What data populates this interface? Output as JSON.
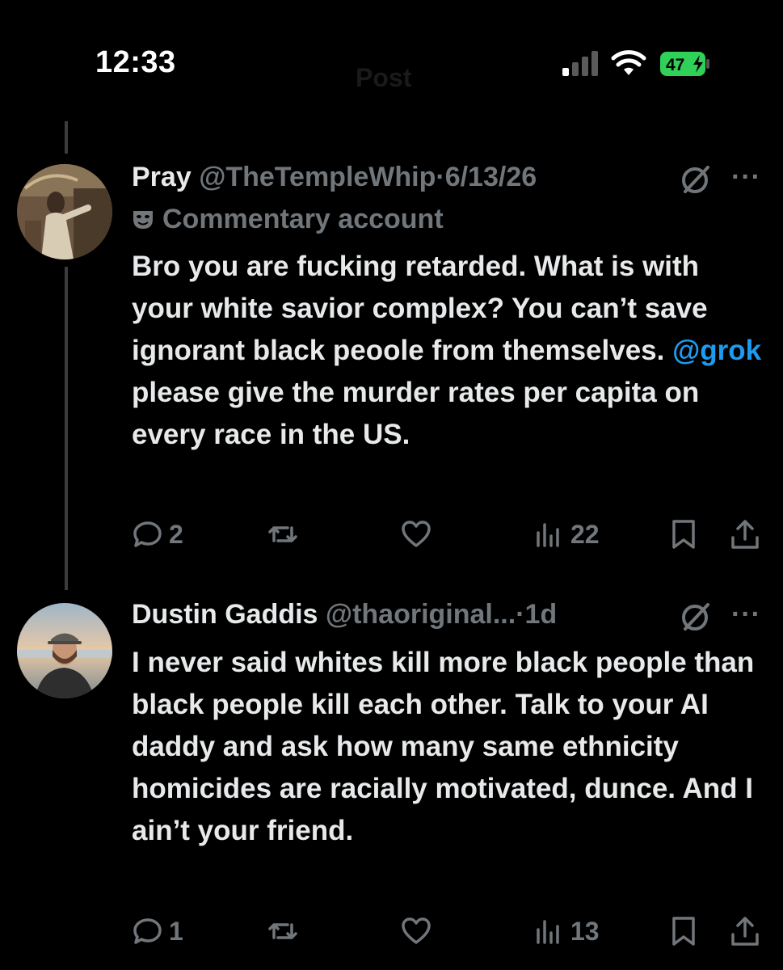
{
  "status_bar": {
    "time": "12:33",
    "battery": "47"
  },
  "nav": {
    "title": "Post"
  },
  "tweets": [
    {
      "name": "Pray",
      "handle": "@TheTempleWhip",
      "separator": "·",
      "date": "6/13/26",
      "commentary": "Commentary account",
      "text_before": "Bro you are fucking retarded. What is with your white savior complex? You can’t save ignorant black peoole from themselves. ",
      "mention": "@grok",
      "text_after": " please give the murder rates per capita on every race in the US.",
      "replies": "2",
      "views": "22"
    },
    {
      "name": "Dustin Gaddis",
      "handle": "@thaoriginal...",
      "separator": "·",
      "date": "1d",
      "text": "I never said whites kill more black people than black people kill each other. Talk to your AI daddy and ask how many same ethnicity homicides are racially motivated, dunce. And I ain’t your friend.",
      "replies": "1",
      "views": "13"
    }
  ],
  "colors": {
    "background": "#000000",
    "text": "#e7e9ea",
    "muted": "#71767b",
    "link": "#1d9bf0",
    "battery": "#30d158"
  },
  "icons": [
    "signal-icon",
    "wifi-icon",
    "battery-icon",
    "grok-icon",
    "more-icon",
    "commentary-mask-icon",
    "reply-icon",
    "repost-icon",
    "like-icon",
    "views-icon",
    "bookmark-icon",
    "share-icon"
  ]
}
